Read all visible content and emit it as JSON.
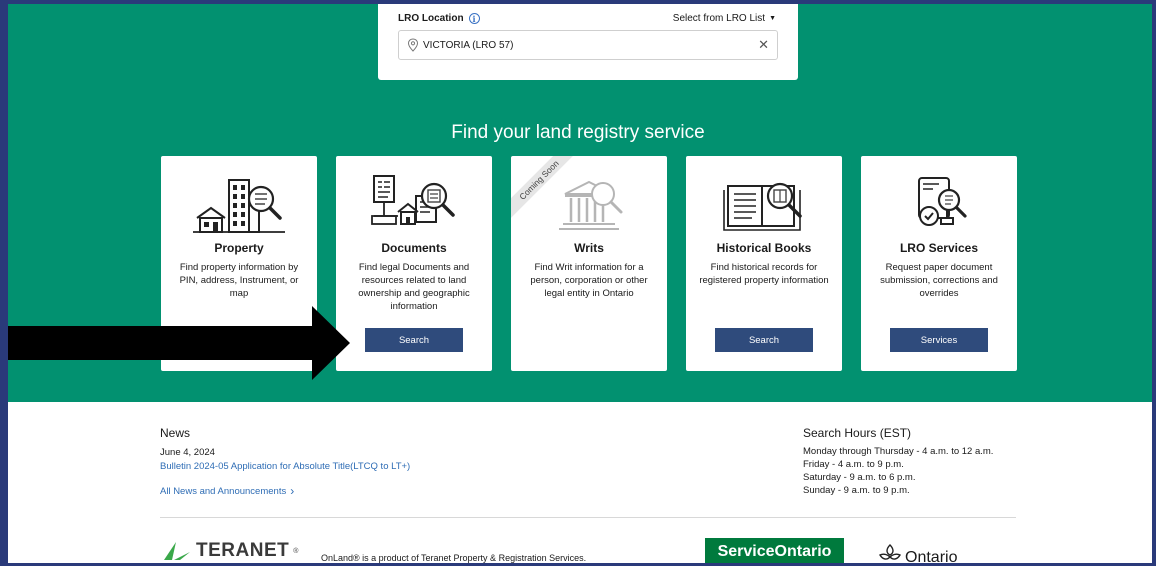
{
  "lro": {
    "label": "LRO Location",
    "select_label": "Select from LRO List",
    "value": "VICTORIA (LRO 57)"
  },
  "hero": {
    "title": "Find your land registry service"
  },
  "cards": [
    {
      "title": "Property",
      "desc": "Find property information by PIN, address, Instrument, or map",
      "button": ""
    },
    {
      "title": "Documents",
      "desc": "Find legal Documents and resources related to land ownership and geographic information",
      "button": "Search"
    },
    {
      "title": "Writs",
      "desc": "Find Writ information for a person, corporation or other legal entity in Ontario",
      "button": "",
      "ribbon": "Coming Soon"
    },
    {
      "title": "Historical Books",
      "desc": "Find historical records for registered property information",
      "button": "Search"
    },
    {
      "title": "LRO Services",
      "desc": "Request paper document submission, corrections and overrides",
      "button": "Services"
    }
  ],
  "news": {
    "title": "News",
    "date": "June 4, 2024",
    "link": "Bulletin 2024-05 Application for Absolute Title(LTCQ to LT+)",
    "all_link": "All News and Announcements"
  },
  "hours": {
    "title": "Search Hours (EST)",
    "lines": [
      "Monday through Thursday - 4 a.m. to 12 a.m.",
      "Friday - 4 a.m. to 9 p.m.",
      "Saturday - 9 a.m. to 6 p.m.",
      "Sunday - 9 a.m. to 9 p.m."
    ]
  },
  "footer": {
    "teranet": "TERANET",
    "teranet_tm": "®",
    "onland": "OnLand® is a product of Teranet Property & Registration Services.",
    "service_ontario": "ServiceOntario",
    "ontario": "Ontario"
  },
  "colors": {
    "hero_green": "#029170",
    "button_navy": "#2f4b7c",
    "link_blue": "#2f6db5",
    "frame_border": "#2a3a7a"
  }
}
